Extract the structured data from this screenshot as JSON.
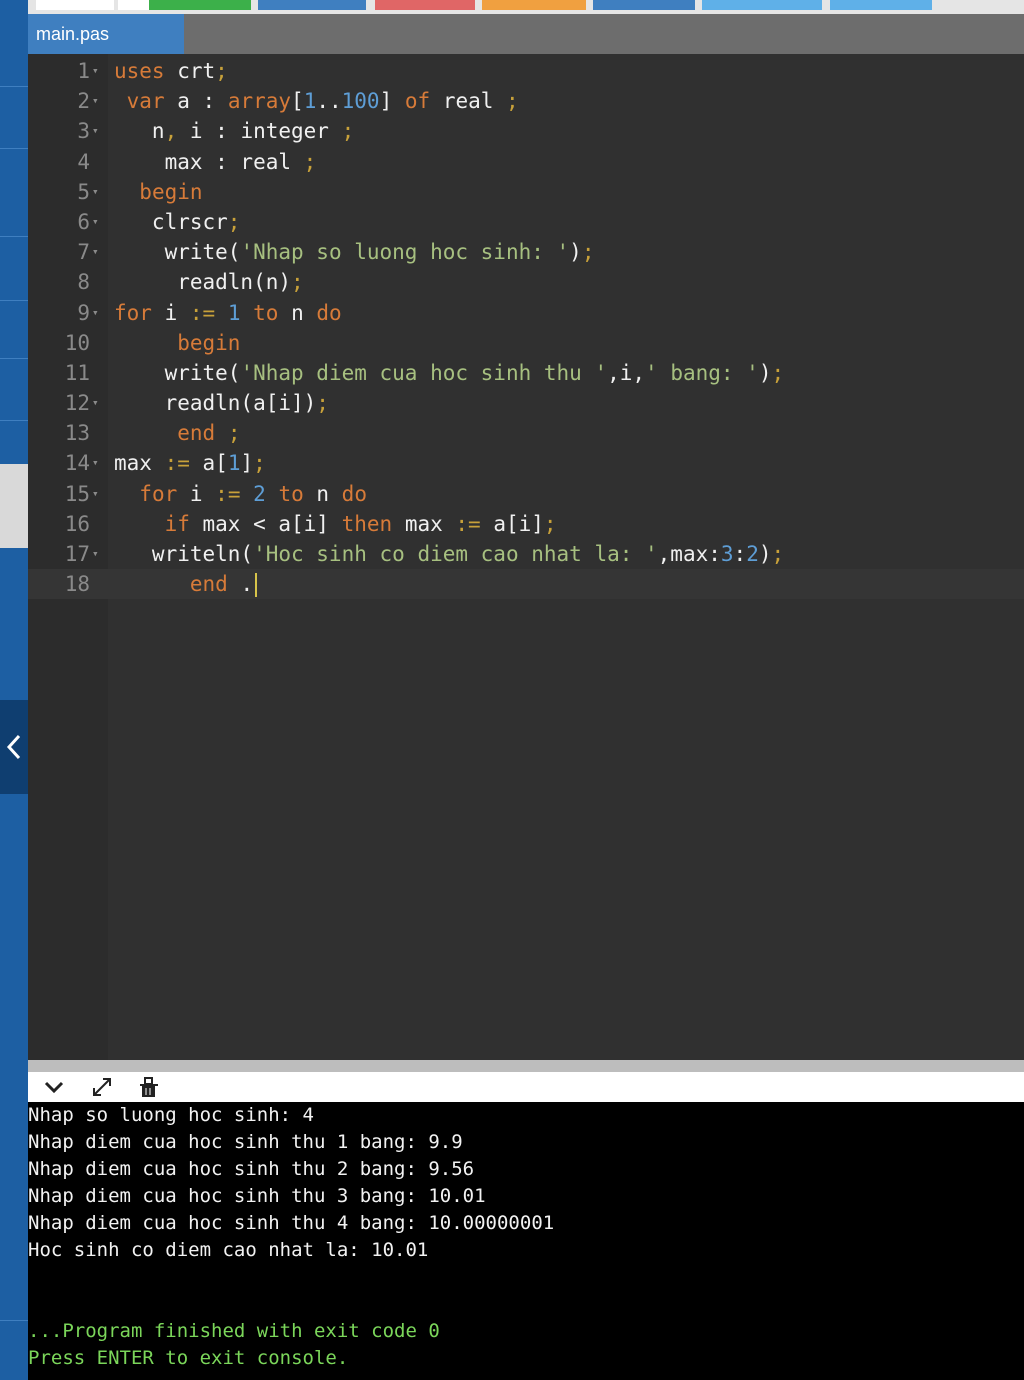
{
  "editor": {
    "tab_label": "main.pas",
    "lines": [
      {
        "no": "1",
        "fold": true,
        "tokens": [
          [
            "kw",
            "uses"
          ],
          [
            "txt",
            " crt"
          ],
          [
            "punc",
            ";"
          ]
        ]
      },
      {
        "no": "2",
        "fold": true,
        "tokens": [
          [
            "txt",
            " "
          ],
          [
            "kw",
            "var"
          ],
          [
            "txt",
            " a : "
          ],
          [
            "kw",
            "array"
          ],
          [
            "txt",
            "["
          ],
          [
            "num",
            "1"
          ],
          [
            "txt",
            ".."
          ],
          [
            "num",
            "100"
          ],
          [
            "txt",
            "] "
          ],
          [
            "kw",
            "of"
          ],
          [
            "txt",
            " real "
          ],
          [
            "punc",
            ";"
          ]
        ]
      },
      {
        "no": "3",
        "fold": true,
        "tokens": [
          [
            "txt",
            "   n"
          ],
          [
            "punc",
            ","
          ],
          [
            "txt",
            " i : integer "
          ],
          [
            "punc",
            ";"
          ]
        ]
      },
      {
        "no": "4",
        "fold": false,
        "tokens": [
          [
            "txt",
            "    max : real "
          ],
          [
            "punc",
            ";"
          ]
        ]
      },
      {
        "no": "5",
        "fold": true,
        "tokens": [
          [
            "txt",
            "  "
          ],
          [
            "kw",
            "begin"
          ]
        ]
      },
      {
        "no": "6",
        "fold": true,
        "tokens": [
          [
            "txt",
            "   clrscr"
          ],
          [
            "punc",
            ";"
          ]
        ]
      },
      {
        "no": "7",
        "fold": true,
        "tokens": [
          [
            "txt",
            "    write("
          ],
          [
            "str",
            "'Nhap so luong hoc sinh: '"
          ],
          [
            "txt",
            ")"
          ],
          [
            "punc",
            ";"
          ]
        ]
      },
      {
        "no": "8",
        "fold": false,
        "tokens": [
          [
            "txt",
            "     readln(n)"
          ],
          [
            "punc",
            ";"
          ]
        ]
      },
      {
        "no": "9",
        "fold": true,
        "tokens": [
          [
            "kw",
            "for"
          ],
          [
            "txt",
            " i "
          ],
          [
            "punc",
            ":="
          ],
          [
            "txt",
            " "
          ],
          [
            "num",
            "1"
          ],
          [
            "txt",
            " "
          ],
          [
            "kw",
            "to"
          ],
          [
            "txt",
            " n "
          ],
          [
            "kw",
            "do"
          ]
        ]
      },
      {
        "no": "10",
        "fold": false,
        "tokens": [
          [
            "txt",
            "     "
          ],
          [
            "kw",
            "begin"
          ]
        ]
      },
      {
        "no": "11",
        "fold": false,
        "tokens": [
          [
            "txt",
            "    write("
          ],
          [
            "str",
            "'Nhap diem cua hoc sinh thu '"
          ],
          [
            "txt",
            ",i,"
          ],
          [
            "str",
            "' bang: '"
          ],
          [
            "txt",
            ")"
          ],
          [
            "punc",
            ";"
          ]
        ]
      },
      {
        "no": "12",
        "fold": true,
        "tokens": [
          [
            "txt",
            "    readln(a[i])"
          ],
          [
            "punc",
            ";"
          ]
        ]
      },
      {
        "no": "13",
        "fold": false,
        "tokens": [
          [
            "txt",
            "     "
          ],
          [
            "kw",
            "end"
          ],
          [
            "txt",
            " "
          ],
          [
            "punc",
            ";"
          ]
        ]
      },
      {
        "no": "14",
        "fold": true,
        "tokens": [
          [
            "txt",
            "max "
          ],
          [
            "punc",
            ":="
          ],
          [
            "txt",
            " a["
          ],
          [
            "num",
            "1"
          ],
          [
            "txt",
            "]"
          ],
          [
            "punc",
            ";"
          ]
        ]
      },
      {
        "no": "15",
        "fold": true,
        "tokens": [
          [
            "txt",
            "  "
          ],
          [
            "kw",
            "for"
          ],
          [
            "txt",
            " i "
          ],
          [
            "punc",
            ":="
          ],
          [
            "txt",
            " "
          ],
          [
            "num",
            "2"
          ],
          [
            "txt",
            " "
          ],
          [
            "kw",
            "to"
          ],
          [
            "txt",
            " n "
          ],
          [
            "kw",
            "do"
          ]
        ]
      },
      {
        "no": "16",
        "fold": false,
        "tokens": [
          [
            "txt",
            "    "
          ],
          [
            "kw",
            "if"
          ],
          [
            "txt",
            " max < a[i] "
          ],
          [
            "kw",
            "then"
          ],
          [
            "txt",
            " max "
          ],
          [
            "punc",
            ":="
          ],
          [
            "txt",
            " a[i]"
          ],
          [
            "punc",
            ";"
          ]
        ]
      },
      {
        "no": "17",
        "fold": true,
        "tokens": [
          [
            "txt",
            "   writeln("
          ],
          [
            "str",
            "'Hoc sinh co diem cao nhat la: '"
          ],
          [
            "txt",
            ",max:"
          ],
          [
            "num",
            "3"
          ],
          [
            "txt",
            ":"
          ],
          [
            "num",
            "2"
          ],
          [
            "txt",
            ")"
          ],
          [
            "punc",
            ";"
          ]
        ]
      },
      {
        "no": "18",
        "fold": false,
        "tokens": [
          [
            "txt",
            "      "
          ],
          [
            "kw",
            "end"
          ],
          [
            "txt",
            " ."
          ]
        ]
      }
    ]
  },
  "console": {
    "lines": [
      "Nhap so luong hoc sinh: 4",
      "Nhap diem cua hoc sinh thu 1 bang: 9.9",
      "Nhap diem cua hoc sinh thu 2 bang: 9.56",
      "Nhap diem cua hoc sinh thu 3 bang: 10.01",
      "Nhap diem cua hoc sinh thu 4 bang: 10.00000001",
      "Hoc sinh co diem cao nhat la: 10.01"
    ],
    "footer": [
      "...Program finished with exit code 0",
      "Press ENTER to exit console."
    ]
  },
  "colors": {
    "toolbar_buttons": [
      "#ffffff",
      "#ffffff",
      "#3cb04a",
      "#3f7fc0",
      "#e06666",
      "#f0a040",
      "#3f7fc0",
      "#5fb0e8",
      "#5fb0e8"
    ]
  },
  "icons": [
    "chevron-left-icon",
    "chevron-down-icon",
    "expand-icon",
    "clear-console-icon"
  ]
}
